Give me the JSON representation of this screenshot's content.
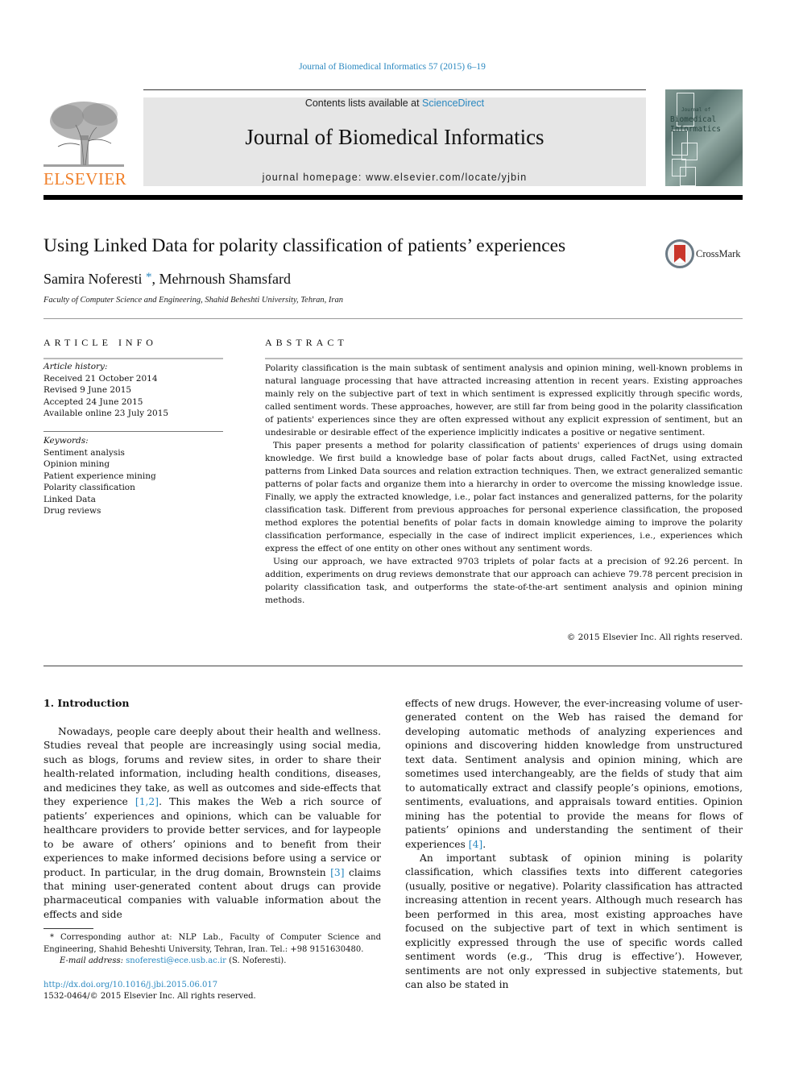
{
  "header": {
    "journal_reference": "Journal of Biomedical Informatics 57 (2015) 6–19",
    "contents_prefix": "Contents lists available at ",
    "contents_link": "ScienceDirect",
    "journal_title": "Journal of Biomedical Informatics",
    "homepage_prefix": "journal homepage: ",
    "homepage_url": "www.elsevier.com/locate/yjbin",
    "publisher_logo_text": "ELSEVIER",
    "cover_text_line1": "Biomedical",
    "cover_text_line2": "Informatics",
    "cover_text_small": "Journal of"
  },
  "article": {
    "title": "Using Linked Data for polarity classification of patients’ experiences",
    "crossmark_label": "CrossMark",
    "authors": [
      {
        "name": "Samira Noferesti",
        "marker": "*"
      },
      {
        "name": "Mehrnoush Shamsfard",
        "marker": ""
      }
    ],
    "author_separator": ", ",
    "affiliation": "Faculty of Computer Science and Engineering, Shahid Beheshti University, Tehran, Iran"
  },
  "article_info": {
    "heading": "ARTICLE INFO",
    "history_label": "Article history:",
    "history": [
      "Received 21 October 2014",
      "Revised 9 June 2015",
      "Accepted 24 June 2015",
      "Available online 23 July 2015"
    ],
    "keywords_label": "Keywords:",
    "keywords": [
      "Sentiment analysis",
      "Opinion mining",
      "Patient experience mining",
      "Polarity classification",
      "Linked Data",
      "Drug reviews"
    ]
  },
  "abstract": {
    "heading": "ABSTRACT",
    "paragraphs": [
      "Polarity classification is the main subtask of sentiment analysis and opinion mining, well-known problems in natural language processing that have attracted increasing attention in recent years. Existing approaches mainly rely on the subjective part of text in which sentiment is expressed explicitly through specific words, called sentiment words. These approaches, however, are still far from being good in the polarity classification of patients' experiences since they are often expressed without any explicit expression of sentiment, but an undesirable or desirable effect of the experience implicitly indicates a positive or negative sentiment.",
      "This paper presents a method for polarity classification of patients' experiences of drugs using domain knowledge. We first build a knowledge base of polar facts about drugs, called FactNet, using extracted patterns from Linked Data sources and relation extraction techniques. Then, we extract generalized semantic patterns of polar facts and organize them into a hierarchy in order to overcome the missing knowledge issue. Finally, we apply the extracted knowledge, i.e., polar fact instances and generalized patterns, for the polarity classification task. Different from previous approaches for personal experience classification, the proposed method explores the potential benefits of polar facts in domain knowledge aiming to improve the polarity classification performance, especially in the case of indirect implicit experiences, i.e., experiences which express the effect of one entity on other ones without any sentiment words.",
      "Using our approach, we have extracted 9703 triplets of polar facts at a precision of 92.26 percent. In addition, experiments on drug reviews demonstrate that our approach can achieve 79.78 percent precision in polarity classification task, and outperforms the state-of-the-art sentiment analysis and opinion mining methods."
    ],
    "copyright": "© 2015 Elsevier Inc. All rights reserved."
  },
  "introduction": {
    "heading": "1. Introduction",
    "left_p1_a": "Nowadays, people care deeply about their health and wellness. Studies reveal that people are increasingly using social media, such as blogs, forums and review sites, in order to share their health-related information, including health conditions, diseases, and medicines they take, as well as outcomes and side-effects that they experience ",
    "left_p1_ref1": "[1,2]",
    "left_p1_b": ". This makes the Web a rich source of patients’ experiences and opinions, which can be valuable for healthcare providers to provide better services, and for laypeople to be aware of others’ opinions and to benefit from their experiences to make informed decisions before using a service or product. In particular, in the drug domain, Brownstein ",
    "left_p1_ref2": "[3]",
    "left_p1_c": " claims that mining user-generated content about drugs can provide pharmaceutical companies with valuable information about the effects and side",
    "right_p1_a": "effects of new drugs. However, the ever-increasing volume of user-generated content on the Web has raised the demand for developing automatic methods of analyzing experiences and opinions and discovering hidden knowledge from unstructured text data. Sentiment analysis and opinion mining, which are sometimes used interchangeably, are the fields of study that aim to automatically extract and classify people’s opinions, emotions, sentiments, evaluations, and appraisals toward entities. Opinion mining has the potential to provide the means for flows of patients’ opinions and understanding the sentiment of their experiences ",
    "right_p1_ref": "[4]",
    "right_p1_b": ".",
    "right_p2": "An important subtask of opinion mining is polarity classification, which classifies texts into different categories (usually, positive or negative). Polarity classification has attracted increasing attention in recent years. Although much research has been performed in this area, most existing approaches have focused on the subjective part of text in which sentiment is explicitly expressed through the use of specific words called sentiment words (e.g., ‘This drug is effective’). However, sentiments are not only expressed in subjective statements, but can also be stated in"
  },
  "footnote": {
    "marker": "*",
    "text": " Corresponding author at: NLP Lab., Faculty of Computer Science and Engineering, Shahid Beheshti University, Tehran, Iran. Tel.: +98 9151630480.",
    "email_label": "E-mail address: ",
    "email": "snoferesti@ece.usb.ac.ir",
    "email_suffix": " (S. Noferesti)."
  },
  "footer": {
    "doi": "http://dx.doi.org/10.1016/j.jbi.2015.06.017",
    "issn_line": "1532-0464/© 2015 Elsevier Inc. All rights reserved."
  },
  "colors": {
    "link": "#2a88c0",
    "elsevier_orange": "#f0802a",
    "masthead_bg": "#e6e6e6"
  }
}
